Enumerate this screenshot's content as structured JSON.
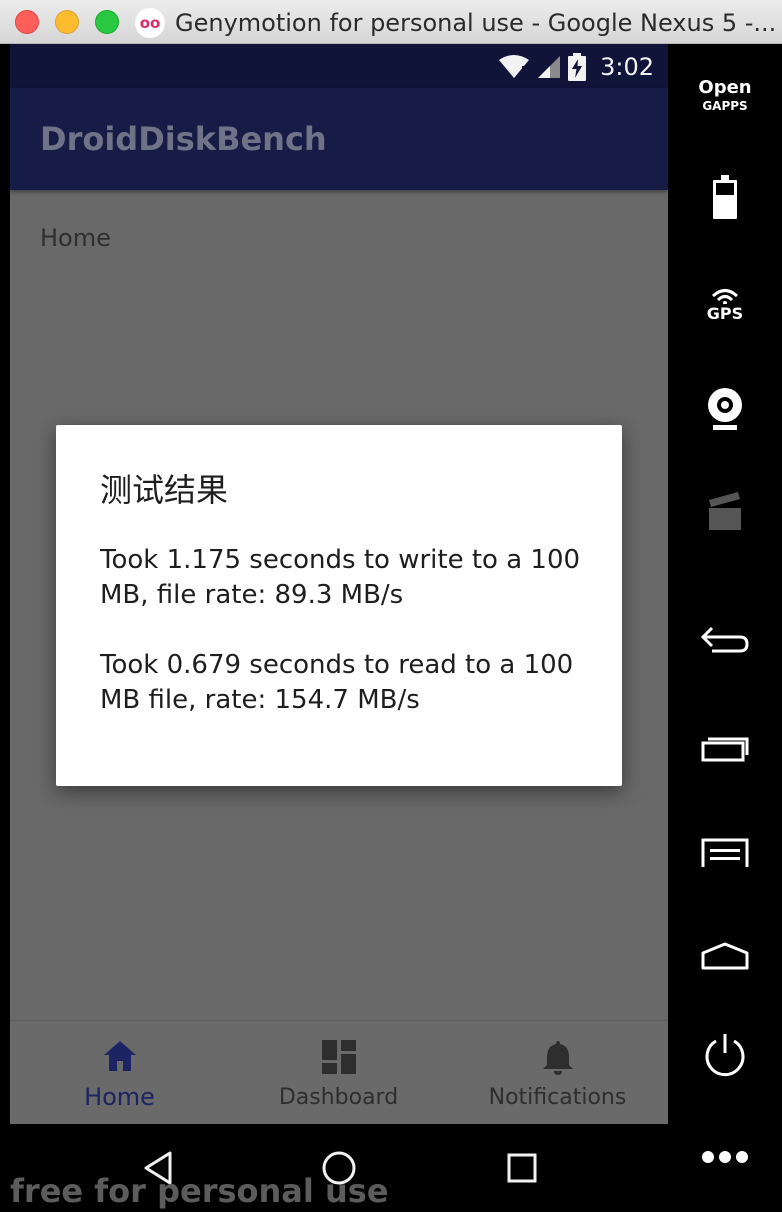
{
  "window": {
    "title": "Genymotion for personal use - Google Nexus 5 -...",
    "logo_text": "oo"
  },
  "status_bar": {
    "time": "3:02"
  },
  "app": {
    "title": "DroidDiskBench"
  },
  "page": {
    "label": "Home"
  },
  "dialog": {
    "title": "测试结果",
    "message": "Took 1.175 seconds to write to a 100 MB, file rate: 89.3 MB/s\n\nTook 0.679 seconds to read to a 100 MB file, rate: 154.7 MB/s"
  },
  "bottom_nav": [
    {
      "label": "Home",
      "icon": "home-icon",
      "active": true
    },
    {
      "label": "Dashboard",
      "icon": "dashboard-icon",
      "active": false
    },
    {
      "label": "Notifications",
      "icon": "bell-icon",
      "active": false
    }
  ],
  "toolbar": {
    "opengapps_line1": "Open",
    "opengapps_line2": "GAPPS",
    "gps_label": "GPS"
  },
  "watermark": "free for personal use",
  "colors": {
    "status_bar": "#101439",
    "app_bar": "#161c46",
    "scrim": "#696969",
    "active_nav": "#1c2463"
  }
}
